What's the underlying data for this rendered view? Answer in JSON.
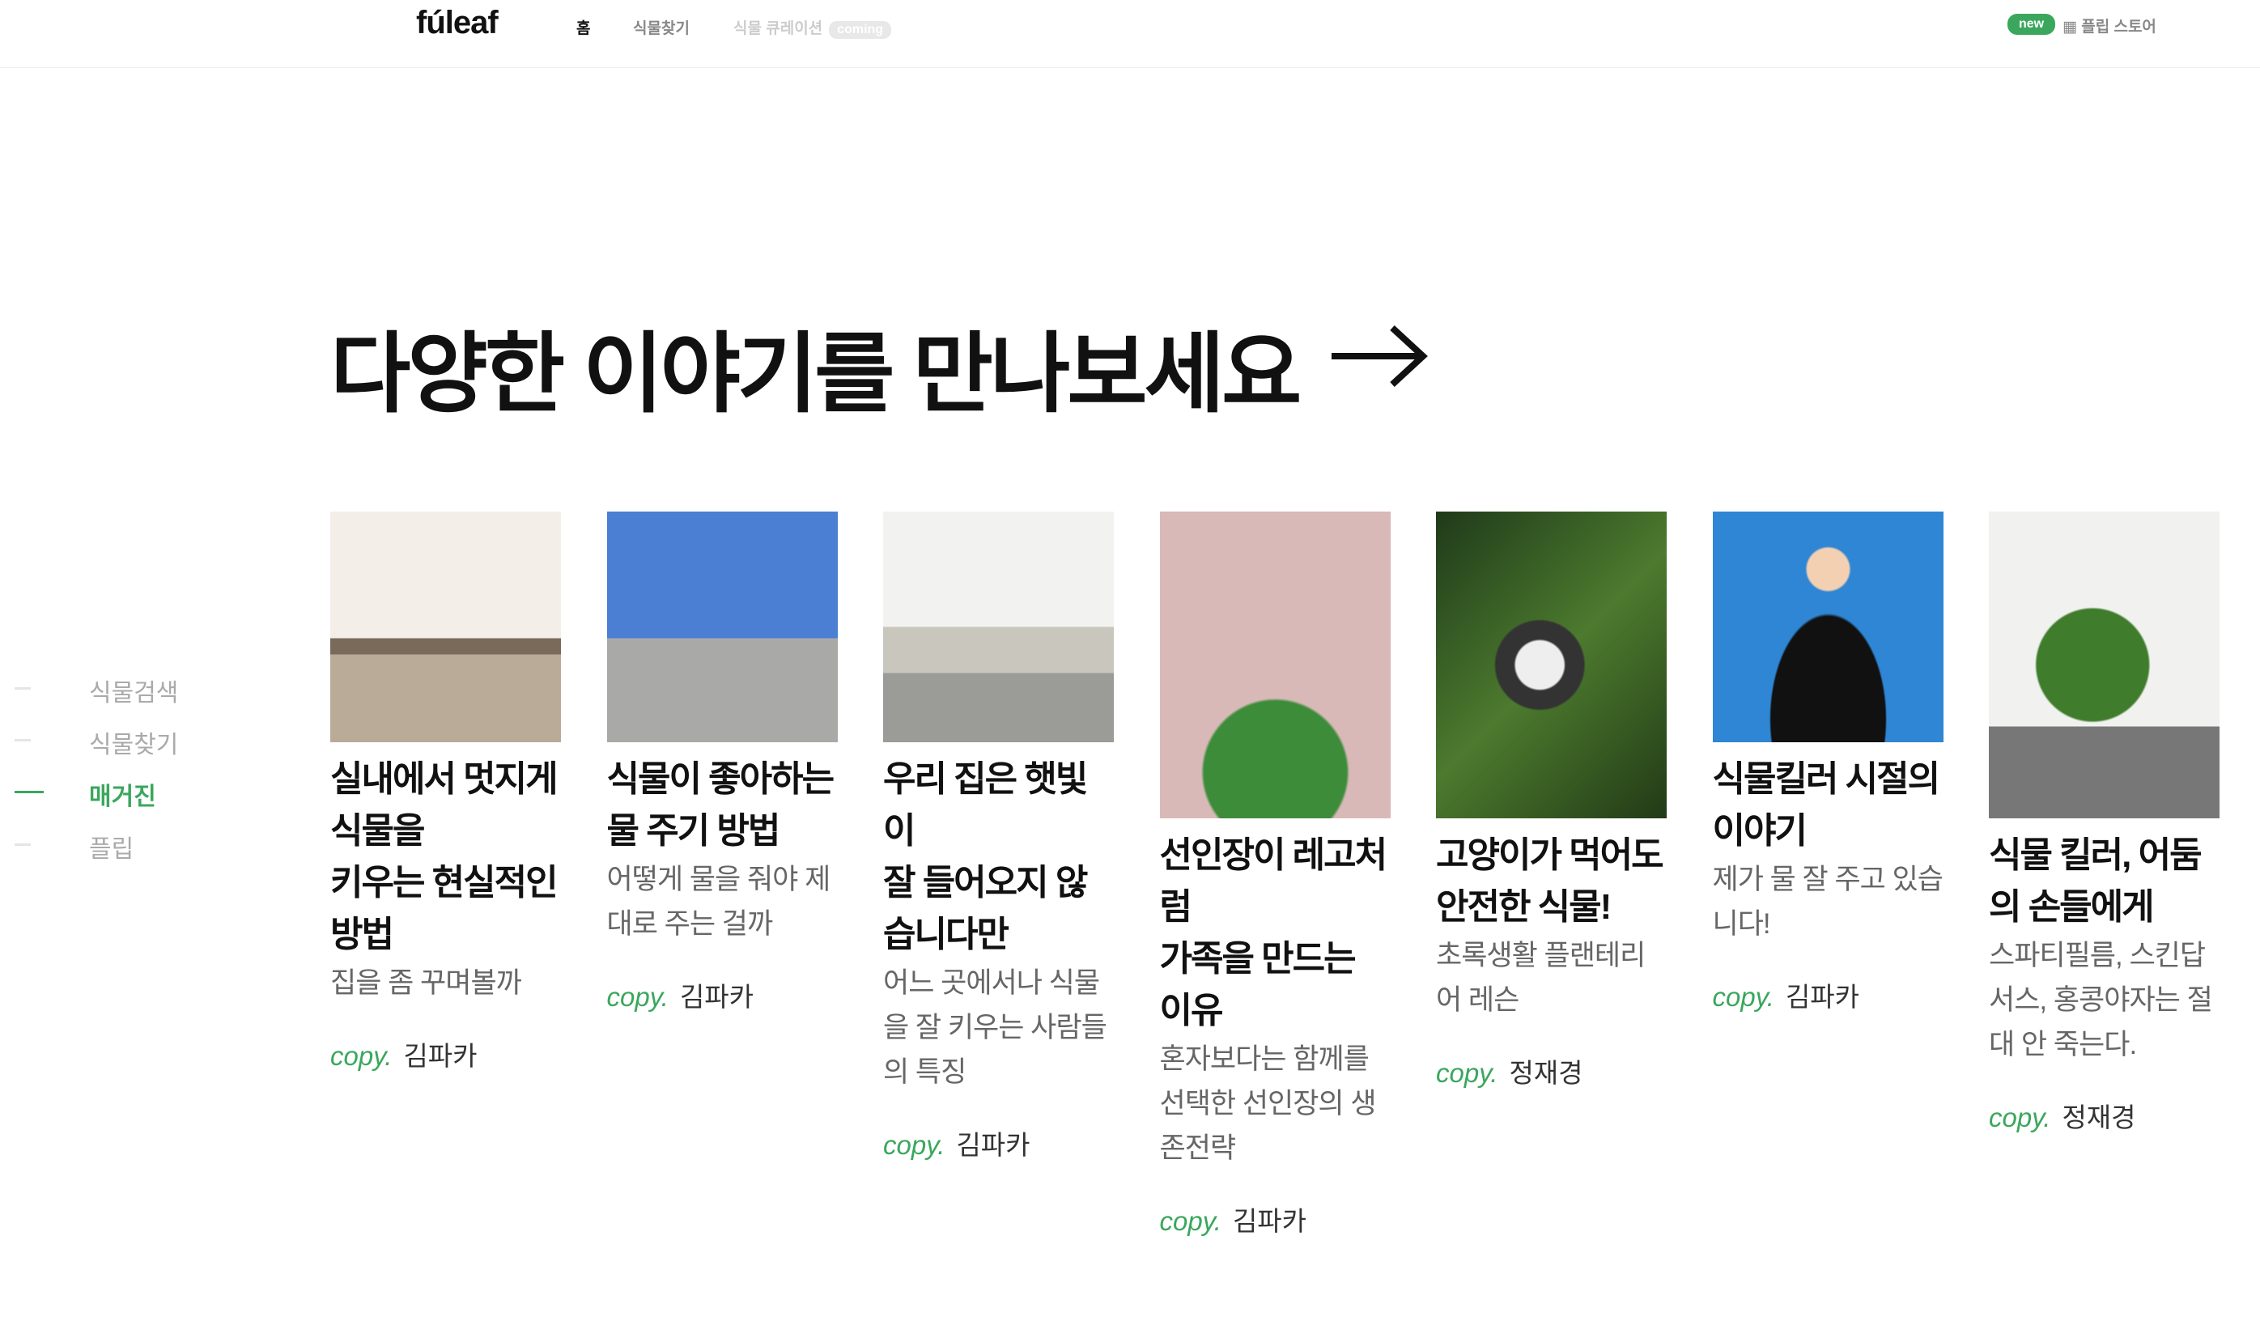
{
  "header": {
    "logo": "fúleaf",
    "nav": [
      "홈",
      "식물찾기",
      "식물 큐레이션"
    ],
    "coming": "coming",
    "new_badge": "new",
    "store": "플립 스토어"
  },
  "main": {
    "title": "다양한 이야기를 만나보세요"
  },
  "sidebar": {
    "items": [
      "식물검색",
      "식물찾기",
      "매거진",
      "플립"
    ],
    "active": 2
  },
  "copy_label": "copy.",
  "cards": [
    {
      "title": "실내에서 멋지게 식물을\n키우는 현실적인 방법",
      "subtitle": "집을 좀 꾸며볼까",
      "author": "김파카"
    },
    {
      "title": "식물이 좋아하는\n물 주기 방법",
      "subtitle": "어떻게 물을 줘야 제대로 주는 걸까",
      "author": "김파카"
    },
    {
      "title": "우리 집은 햇빛이\n잘 들어오지 않습니다만",
      "subtitle": "어느 곳에서나 식물을 잘 키우는 사람들의 특징",
      "author": "김파카"
    },
    {
      "title": "선인장이 레고처럼\n가족을 만드는 이유",
      "subtitle": "혼자보다는 함께를 선택한 선인장의 생존전략",
      "author": "김파카"
    },
    {
      "title": "고양이가 먹어도 안전한 식물!",
      "subtitle": "초록생활 플랜테리어 레슨",
      "author": "정재경"
    },
    {
      "title": "식물킬러 시절의 이야기",
      "subtitle": "제가 물 잘 주고 있습니다!",
      "author": "김파카"
    },
    {
      "title": "식물 킬러, 어둠의 손들에게",
      "subtitle": "스파티필름, 스킨답서스, 홍콩야자는 절대 안 죽는다.",
      "author": "정재경"
    }
  ],
  "colors": {
    "accent": "#3aa75d"
  }
}
